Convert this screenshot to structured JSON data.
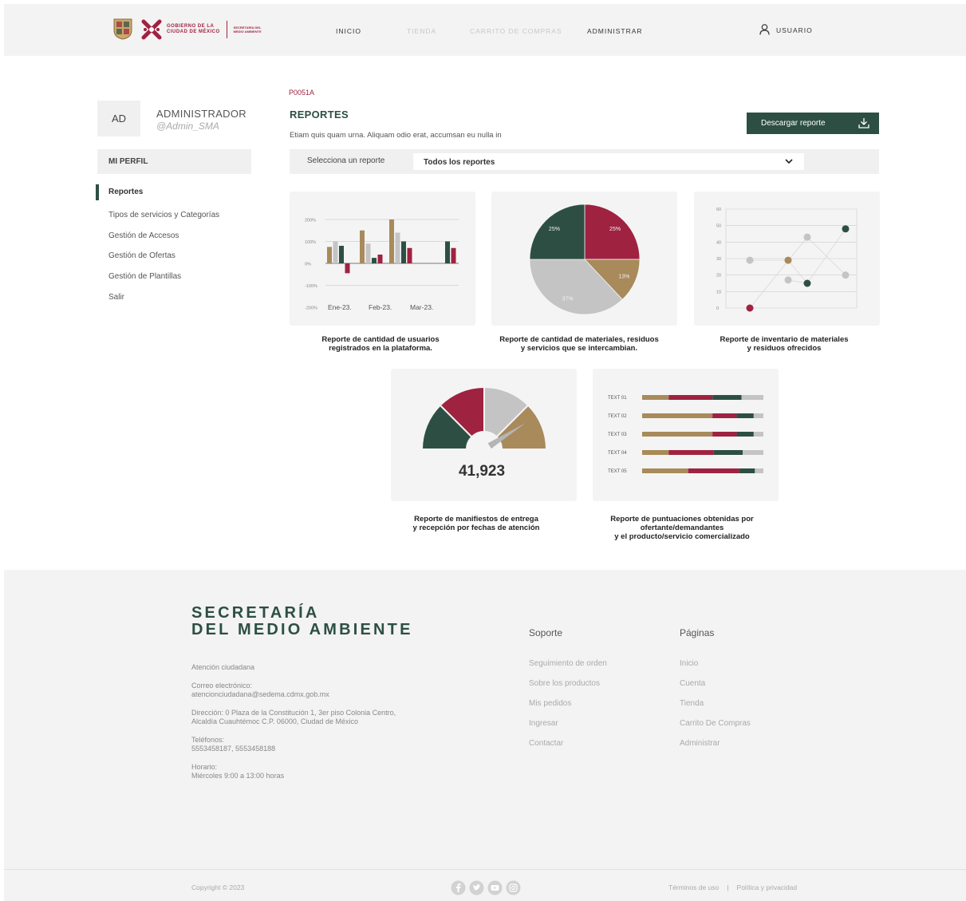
{
  "header": {
    "logo_lines": [
      "GOBIERNO DE LA",
      "CIUDAD DE MÉXICO"
    ],
    "secretaria_lines": [
      "SECRETARÍA DEL",
      "MEDIO AMBIENTE"
    ],
    "nav": [
      "INICIO",
      "TIENDA",
      "CARRITO DE COMPRAS",
      "ADMINISTRAR"
    ],
    "user_label": "USUARIO"
  },
  "sidebar": {
    "avatar_initials": "AD",
    "name": "ADMINISTRADOR",
    "handle": "@Admin_SMA",
    "profile_label": "MI PERFIL",
    "items": [
      "Reportes",
      "Tipos de servicios y Categorías",
      "Gestión de Accesos",
      "Gestión de Ofertas",
      "Gestión de Plantillas",
      "Salir"
    ]
  },
  "main": {
    "code": "P0051A",
    "title": "REPORTES",
    "description": "Etiam quis quam urna. Aliquam odio erat, accumsan eu nulla in",
    "download_label": "Descargar reporte",
    "filter_label": "Selecciona un reporte",
    "filter_value": "Todos los reportes",
    "captions": [
      [
        "Reporte de cantidad de usuarios",
        "registrados en la plataforma."
      ],
      [
        "Reporte de cantidad de materiales, residuos",
        "y servicios que se intercambian."
      ],
      [
        "Reporte de inventario de materiales",
        "y residuos ofrecidos"
      ],
      [
        "Reporte de manifiestos de entrega",
        "y recepción por fechas de atención"
      ],
      [
        "Reporte de puntuaciones obtenidas por",
        "ofertante/demandantes",
        "y el producto/servicio comercializado"
      ]
    ]
  },
  "colors": {
    "green": "#2d4f43",
    "wine": "#9f2241",
    "gold": "#a88a5b",
    "gray": "#c4c4c4"
  },
  "chart_data": [
    {
      "type": "bar",
      "categories": [
        "Ene-23.",
        "Feb-23.",
        "Mar-23."
      ],
      "yticks": [
        "200%",
        "100%",
        "0%",
        "-100%",
        "-200%"
      ],
      "ylim": [
        -200,
        200
      ],
      "series": [
        {
          "color": "#a88a5b",
          "values": [
            75,
            150,
            200,
            0
          ]
        },
        {
          "color": "#c4c4c4",
          "values": [
            100,
            90,
            140,
            0
          ]
        },
        {
          "color": "#2d4f43",
          "values": [
            80,
            25,
            100,
            100
          ]
        },
        {
          "color": "#9f2241",
          "values": [
            -45,
            40,
            70,
            70
          ]
        }
      ]
    },
    {
      "type": "pie",
      "slices": [
        {
          "label": "25%",
          "value": 25,
          "color": "#9f2241"
        },
        {
          "label": "13%",
          "value": 13,
          "color": "#a88a5b"
        },
        {
          "label": "37%",
          "value": 37,
          "color": "#c4c4c4"
        },
        {
          "label": "25%",
          "value": 25,
          "color": "#2d4f43"
        }
      ]
    },
    {
      "type": "scatter",
      "yticks": [
        "60",
        "50",
        "40",
        "30",
        "20",
        "10",
        "0"
      ],
      "ylim": [
        0,
        60
      ],
      "series": [
        {
          "color": "#c4c4c4",
          "points": [
            [
              1,
              29
            ],
            [
              3,
              17
            ],
            [
              4,
              43
            ],
            [
              6,
              20
            ]
          ]
        },
        {
          "color": "#9f2241",
          "points": [
            [
              1,
              0
            ]
          ]
        },
        {
          "color": "#a88a5b",
          "points": [
            [
              3,
              29
            ]
          ]
        },
        {
          "color": "#2d4f43",
          "points": [
            [
              4,
              15
            ],
            [
              6,
              48
            ]
          ]
        }
      ]
    },
    {
      "type": "gauge",
      "value_label": "41,923",
      "segments": [
        "#2d4f43",
        "#9f2241",
        "#c4c4c4",
        "#a88a5b"
      ],
      "needle_fraction": 0.82
    },
    {
      "type": "bar",
      "orientation": "horizontal-stacked",
      "categories": [
        "TEXT 01",
        "TEXT 02",
        "TEXT 03",
        "TEXT 04",
        "TEXT 05"
      ],
      "series": [
        {
          "color": "#a88a5b",
          "values": [
            22,
            58,
            58,
            22,
            38
          ]
        },
        {
          "color": "#9f2241",
          "values": [
            36,
            20,
            20,
            37,
            42
          ]
        },
        {
          "color": "#2d4f43",
          "values": [
            24,
            14,
            14,
            24,
            13
          ]
        },
        {
          "color": "#c4c4c4",
          "values": [
            18,
            8,
            8,
            17,
            7
          ]
        }
      ]
    }
  ],
  "footer": {
    "brand_lines": [
      "SECRETARÍA",
      "DEL MEDIO AMBIENTE"
    ],
    "info": [
      [
        "Atención ciudadana"
      ],
      [
        "Correo electrónico:",
        "atencionciudadana@sedema.cdmx.gob.mx"
      ],
      [
        "Dirección: 0 Plaza de la Constitución 1, 3er piso Colonia Centro,",
        "Alcaldía Cuauhtémoc C.P. 06000, Ciudad de México"
      ],
      [
        "Teléfonos:",
        "5553458187, 5553458188"
      ],
      [
        "Horario:",
        "Miércoles 9:00 a 13:00 horas"
      ]
    ],
    "support_title": "Soporte",
    "support_links": [
      "Seguimiento de orden",
      "Sobre los productos",
      "Mis pedidos",
      "Ingresar",
      "Contactar"
    ],
    "pages_title": "Páginas",
    "pages_links": [
      "Inicio",
      "Cuenta",
      "Tienda",
      "Carrito De Compras",
      "Administrar"
    ],
    "copyright": "Copyright © 2023",
    "terms": "Términos de uso",
    "separator": "|",
    "privacy": "Política y privacidad",
    "socials": [
      "facebook-icon",
      "twitter-icon",
      "youtube-icon",
      "instagram-icon"
    ]
  }
}
